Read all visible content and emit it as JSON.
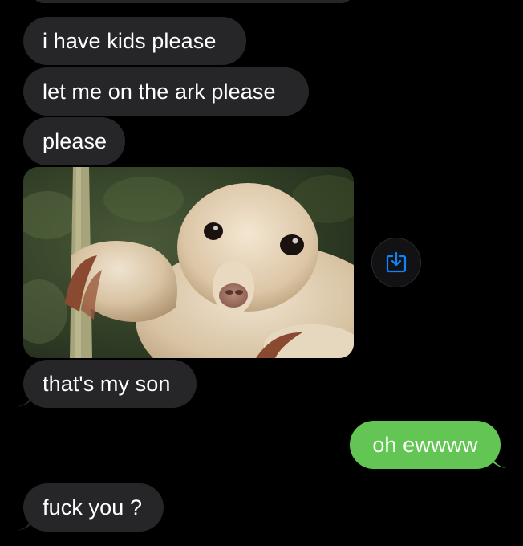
{
  "messages": [
    {
      "id": "m1",
      "direction": "incoming",
      "text": "i have kids please"
    },
    {
      "id": "m2",
      "direction": "incoming",
      "text": "let me on the ark please"
    },
    {
      "id": "m3",
      "direction": "incoming",
      "text": "please"
    },
    {
      "id": "m4",
      "direction": "incoming",
      "type": "image",
      "image_subject": "silky-anteater-photo"
    },
    {
      "id": "m5",
      "direction": "incoming",
      "text": "that's my son"
    },
    {
      "id": "m6",
      "direction": "outgoing",
      "text": "oh ewwww"
    },
    {
      "id": "m7",
      "direction": "incoming",
      "text": "fuck you ?"
    }
  ],
  "image_actions": {
    "save_icon": "download-icon"
  },
  "colors": {
    "background": "#000000",
    "incoming_bubble": "#262628",
    "outgoing_bubble": "#63c553",
    "accent_blue": "#0a84ff"
  }
}
